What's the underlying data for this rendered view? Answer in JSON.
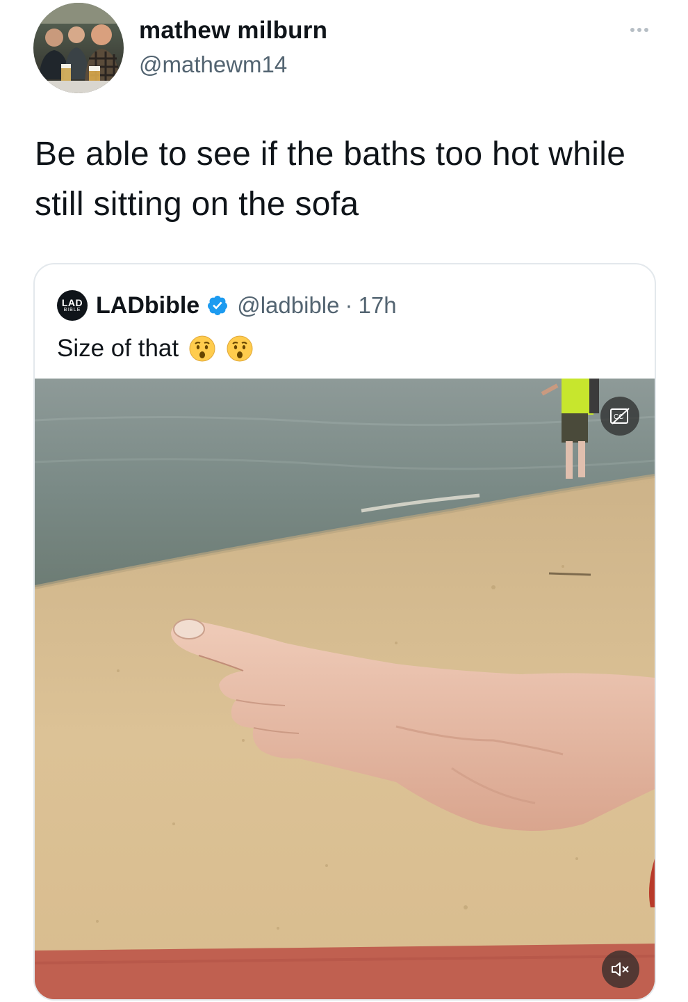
{
  "tweet": {
    "author": {
      "display_name": "mathew milburn",
      "handle": "@mathewm14",
      "avatar_icon": "profile-photo"
    },
    "more_icon": "more-options-icon",
    "text": "Be able to see if the baths too hot while still sitting on the sofa"
  },
  "quoted_tweet": {
    "avatar_logo": {
      "line1": "LAD",
      "line2": "BIBLE"
    },
    "display_name": "LADbible",
    "verified": true,
    "verified_color": "#1d9bf0",
    "handle": "@ladbible",
    "separator": "·",
    "time": "17h",
    "text": "Size of that",
    "emojis": [
      "hushed-face-emoji",
      "hushed-face-emoji"
    ],
    "media": {
      "type": "video",
      "description_icon": "beach-foot-video",
      "controls": {
        "captions_icon": "closed-captions-icon",
        "mute_icon": "speaker-muted-icon"
      }
    }
  },
  "colors": {
    "text_primary": "#0f1419",
    "text_secondary": "#536471",
    "border": "#e3e8ec",
    "verified_blue": "#1d9bf0"
  }
}
